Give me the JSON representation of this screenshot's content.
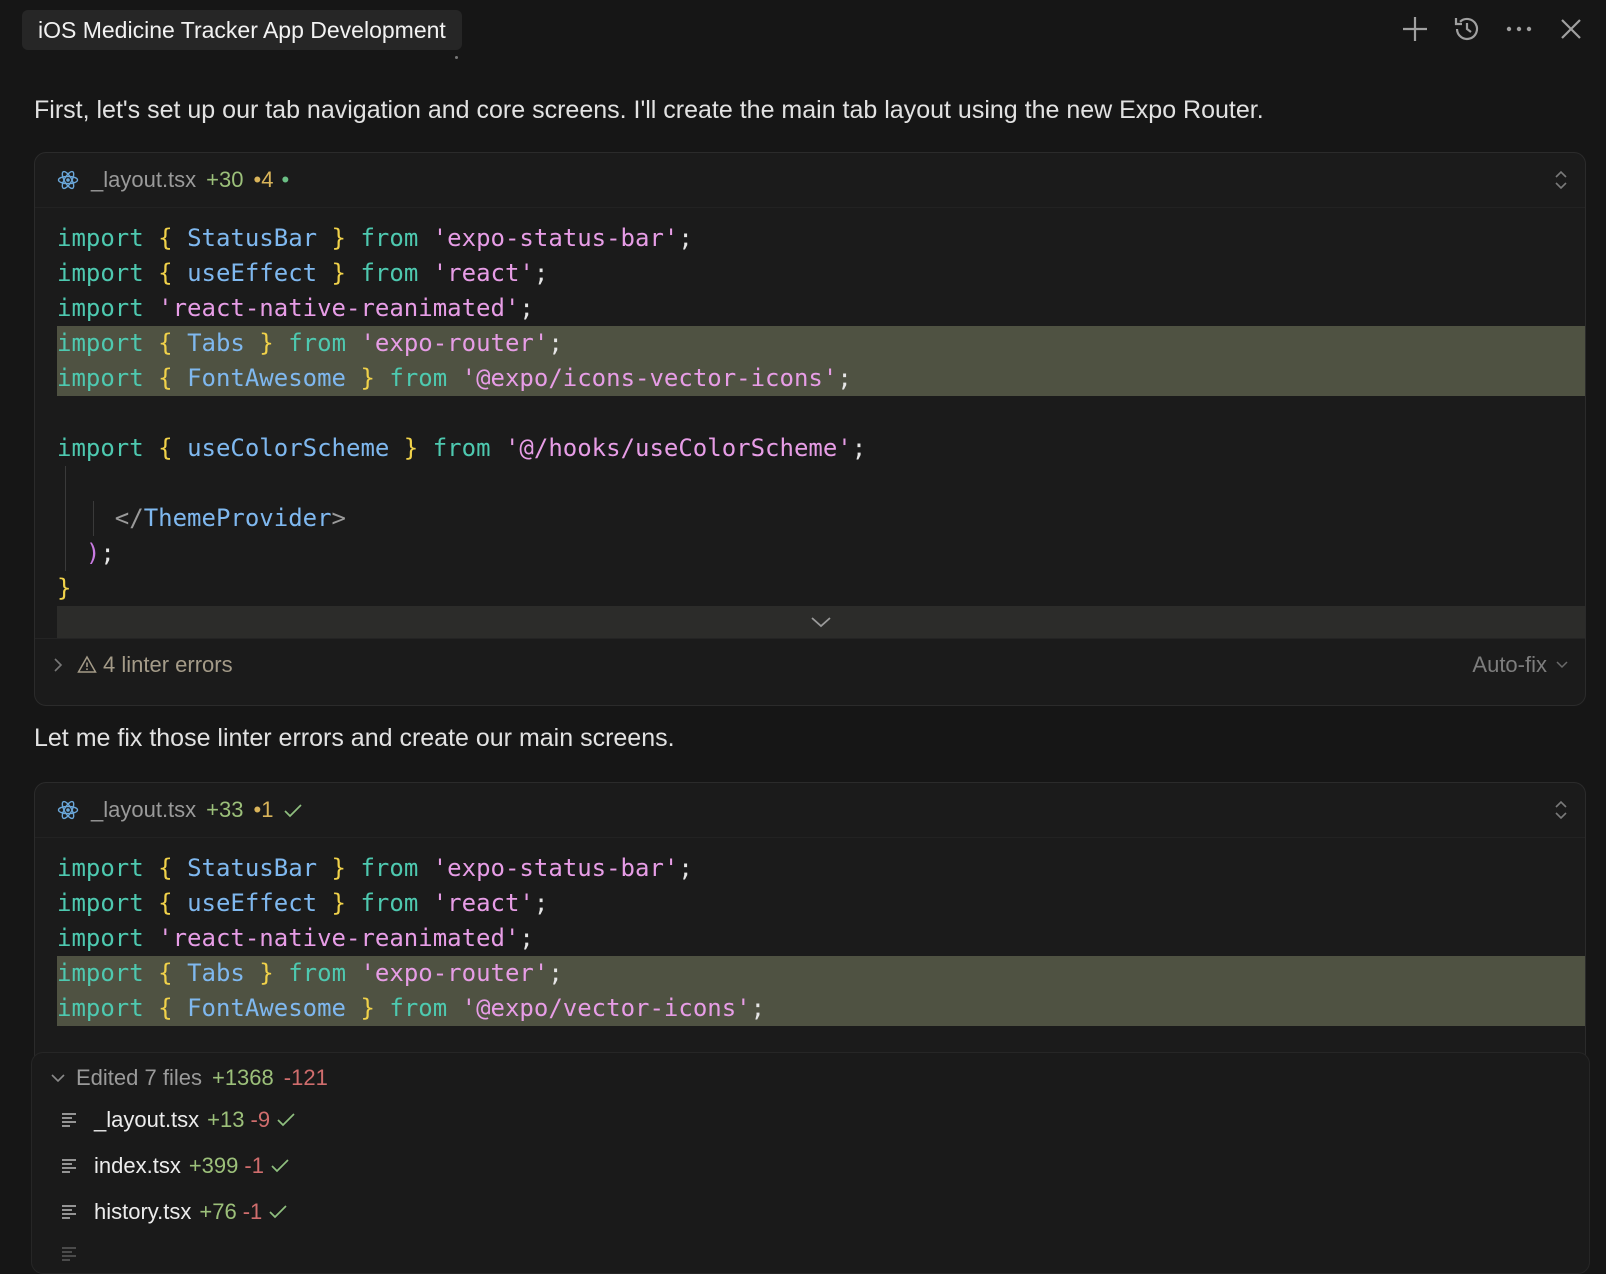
{
  "window": {
    "title": "iOS Medicine Tracker App Development"
  },
  "messages": [
    {
      "text": "First, let's set up our tab navigation and core screens. I'll create the main tab layout using the new Expo Router."
    },
    {
      "text": "Let me fix those linter errors and create our main screens."
    }
  ],
  "block1": {
    "filename": "_layout.tsx",
    "added": "+30",
    "modified": "•4",
    "status_dot": "•",
    "lines": [
      {
        "kw": "import",
        "ob": "{ ",
        "id": "StatusBar",
        "cb": " }",
        "from": "from",
        "str": "'expo-status-bar'",
        "end": ";"
      },
      {
        "kw": "import",
        "ob": "{ ",
        "id": "useEffect",
        "cb": " }",
        "from": "from",
        "str": "'react'",
        "end": ";"
      },
      {
        "kw": "import",
        "str": "'react-native-reanimated'",
        "end": ";"
      },
      {
        "kw": "import",
        "ob": "{ ",
        "id": "Tabs",
        "cb": " }",
        "from": "from",
        "str": "'expo-router'",
        "end": ";"
      },
      {
        "kw": "import",
        "ob": "{ ",
        "id": "FontAwesome",
        "cb": " }",
        "from": "from",
        "str": "'@expo/icons-vector-icons'",
        "end": ";"
      },
      {
        "kw": "import",
        "ob": "{ ",
        "id": "useColorScheme",
        "cb": " }",
        "from": "from",
        "str": "'@/hooks/useColorScheme'",
        "end": ";"
      }
    ],
    "closing_tag_open": "</",
    "closing_tag_name": "ThemeProvider",
    "closing_tag_end": ">",
    "paren_close": ")",
    "semicolon": ";",
    "brace_close": "}",
    "linter": "4 linter errors",
    "autofix": "Auto-fix"
  },
  "block2": {
    "filename": "_layout.tsx",
    "added": "+33",
    "modified": "•1",
    "lines": [
      {
        "kw": "import",
        "ob": "{ ",
        "id": "StatusBar",
        "cb": " }",
        "from": "from",
        "str": "'expo-status-bar'",
        "end": ";"
      },
      {
        "kw": "import",
        "ob": "{ ",
        "id": "useEffect",
        "cb": " }",
        "from": "from",
        "str": "'react'",
        "end": ";"
      },
      {
        "kw": "import",
        "str": "'react-native-reanimated'",
        "end": ";"
      },
      {
        "kw": "import",
        "ob": "{ ",
        "id": "Tabs",
        "cb": " }",
        "from": "from",
        "str": "'expo-router'",
        "end": ";"
      },
      {
        "kw": "import",
        "ob": "{ ",
        "id": "FontAwesome",
        "cb": " }",
        "from": "from",
        "str": "'@expo/vector-icons'",
        "end": ";"
      }
    ]
  },
  "edited": {
    "label": "Edited 7 files",
    "added": "+1368",
    "removed": "-121",
    "files": [
      {
        "name": "_layout.tsx",
        "added": "+13",
        "removed": "-9"
      },
      {
        "name": "index.tsx",
        "added": "+399",
        "removed": "-1"
      },
      {
        "name": "history.tsx",
        "added": "+76",
        "removed": "-1"
      }
    ]
  },
  "colors": {
    "background": "#161616",
    "keyword": "#4ec9b0",
    "identifier": "#7fb8ef",
    "string": "#e79de6",
    "brace": "#f1d24a",
    "added": "#9cc07a",
    "removed": "#d06d6d",
    "highlight": "#4f5242"
  }
}
